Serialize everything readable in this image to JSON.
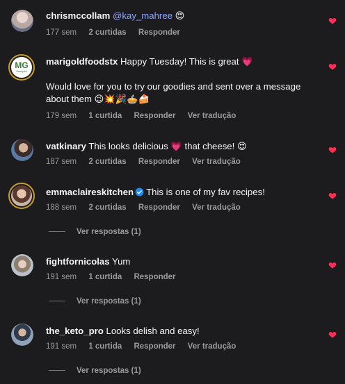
{
  "labels": {
    "reply": "Responder",
    "translate": "Ver tradução"
  },
  "colors": {
    "heart": "#ff2e55",
    "mention": "#8fa6ff",
    "verified": "#1d8cf0"
  },
  "comments": [
    {
      "username": "chrismccollam",
      "mention": "@kay_mahree",
      "text": "😍",
      "time": "177 sem",
      "likes": "2 curtidas",
      "avatar_icon": "user-photo"
    },
    {
      "username": "marigoldfoodstx",
      "text": "Happy Tuesday! This is great 💗",
      "text2": "Would love for you to try our goodies and sent over a message about them 😉💥🎉🥧🍰",
      "time": "179 sem",
      "likes": "1 curtida",
      "avatar_icon": "marigold-logo",
      "avatar_text": "Marigold"
    },
    {
      "username": "vatkinary",
      "text": "This looks delicious 💗  that cheese! 😍",
      "time": "187 sem",
      "likes": "2 curtidas",
      "avatar_icon": "user-photo"
    },
    {
      "username": "emmaclaireskitchen",
      "text": "This is one of my fav recipes!",
      "time": "188 sem",
      "likes": "2 curtidas",
      "verified": true,
      "replies": "Ver respostas (1)",
      "avatar_icon": "user-photo"
    },
    {
      "username": "fightfornicolas",
      "text": "Yum",
      "time": "191 sem",
      "likes": "1 curtida",
      "replies": "Ver respostas (1)",
      "avatar_icon": "user-photo"
    },
    {
      "username": "the_keto_pro",
      "text": "Looks delish and easy!",
      "time": "191 sem",
      "likes": "1 curtida",
      "replies": "Ver respostas (1)",
      "avatar_icon": "user-photo"
    }
  ]
}
